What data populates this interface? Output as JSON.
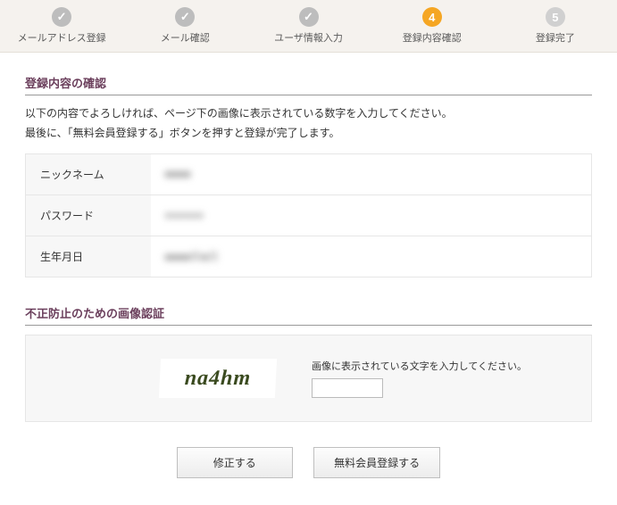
{
  "progress": {
    "steps": [
      {
        "label": "メールアドレス登録",
        "state": "done"
      },
      {
        "label": "メール確認",
        "state": "done"
      },
      {
        "label": "ユーザ情報入力",
        "state": "done"
      },
      {
        "label": "登録内容確認",
        "state": "active",
        "num": "4"
      },
      {
        "label": "登録完了",
        "state": "future",
        "num": "5"
      }
    ]
  },
  "section_confirm": {
    "title": "登録内容の確認",
    "intro1": "以下の内容でよろしければ、ページ下の画像に表示されている数字を入力してください。",
    "intro2": "最後に、「無料会員登録する」ボタンを押すと登録が完了します。",
    "rows": {
      "nickname_label": "ニックネーム",
      "nickname_value": "■■■■",
      "password_label": "パスワード",
      "password_value": "●●●●●●",
      "dob_label": "生年月日",
      "dob_value": "■■■■年■月"
    }
  },
  "section_captcha": {
    "title": "不正防止のための画像認証",
    "captcha_text": "na4hm",
    "prompt": "画像に表示されている文字を入力してください。",
    "input_value": ""
  },
  "buttons": {
    "edit": "修正する",
    "submit": "無料会員登録する"
  }
}
